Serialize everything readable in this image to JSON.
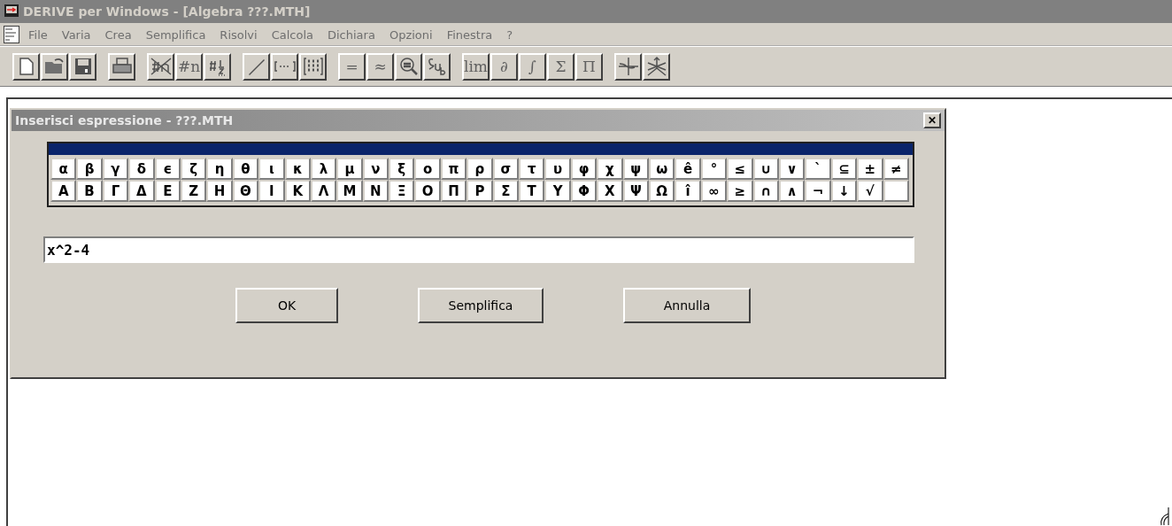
{
  "window": {
    "title": "DERIVE per Windows - [Algebra  ???.MTH]"
  },
  "menu": [
    "File",
    "Varia",
    "Crea",
    "Semplifica",
    "Risolvi",
    "Calcola",
    "Dichiara",
    "Opzioni",
    "Finestra",
    "?"
  ],
  "toolbar": [
    [
      {
        "kind": "icon"
      },
      {
        "kind": "icon"
      },
      {
        "kind": "icon"
      }
    ],
    [
      {
        "kind": "icon"
      }
    ],
    [
      {
        "kind": "icon"
      },
      {
        "kind": "text",
        "label": "#n"
      },
      {
        "kind": "icon"
      }
    ],
    [
      {
        "kind": "icon"
      },
      {
        "kind": "icon"
      },
      {
        "kind": "icon"
      }
    ],
    [
      {
        "kind": "text",
        "label": "="
      },
      {
        "kind": "text",
        "label": "≈"
      },
      {
        "kind": "icon"
      },
      {
        "kind": "icon"
      }
    ],
    [
      {
        "kind": "text",
        "label": "lim"
      },
      {
        "kind": "text",
        "label": "∂"
      },
      {
        "kind": "text",
        "label": "∫"
      },
      {
        "kind": "text",
        "label": "Σ"
      },
      {
        "kind": "text",
        "label": "Π"
      }
    ],
    [
      {
        "kind": "icon"
      },
      {
        "kind": "icon"
      }
    ]
  ],
  "dialog": {
    "title": "Inserisci espressione - ???.MTH",
    "close": "✕",
    "symbols": [
      [
        "α",
        "β",
        "γ",
        "δ",
        "ϵ",
        "ζ",
        "η",
        "θ",
        "ι",
        "κ",
        "λ",
        "μ",
        "ν",
        "ξ",
        "ο",
        "π",
        "ρ",
        "σ",
        "τ",
        "υ",
        "φ",
        "χ",
        "ψ",
        "ω",
        "ê",
        "°",
        "≤",
        "∪",
        "∨",
        "`",
        "⊆",
        "±",
        "≠"
      ],
      [
        "Α",
        "Β",
        "Γ",
        "Δ",
        "Ε",
        "Ζ",
        "Η",
        "Θ",
        "Ι",
        "Κ",
        "Λ",
        "Μ",
        "Ν",
        "Ξ",
        "Ο",
        "Π",
        "Ρ",
        "Σ",
        "Τ",
        "Υ",
        "Φ",
        "Χ",
        "Ψ",
        "Ω",
        "î",
        "∞",
        "≥",
        "∩",
        "∧",
        "¬",
        "↓",
        "√"
      ]
    ],
    "expression": "x^2-4",
    "buttons": [
      "OK",
      "Semplifica",
      "Annulla"
    ]
  }
}
